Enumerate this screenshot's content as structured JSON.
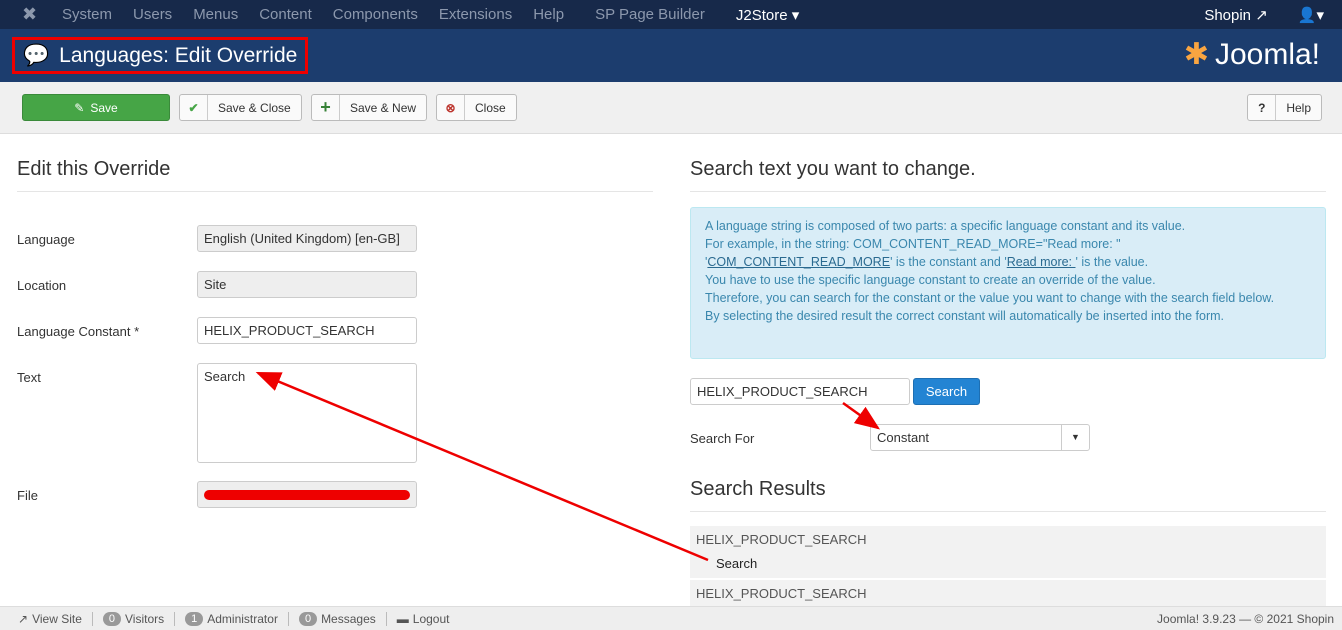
{
  "topnav": {
    "items": [
      "System",
      "Users",
      "Menus",
      "Content",
      "Components",
      "Extensions",
      "Help",
      "SP Page Builder"
    ],
    "j2store": "J2Store",
    "site": "Shopin"
  },
  "header": {
    "title": "Languages: Edit Override",
    "brand": "Joomla!"
  },
  "toolbar": {
    "save": "Save",
    "save_close": "Save & Close",
    "save_new": "Save & New",
    "close": "Close",
    "help": "Help"
  },
  "left": {
    "heading": "Edit this Override",
    "language_label": "Language",
    "language_value": "English (United Kingdom) [en-GB]",
    "location_label": "Location",
    "location_value": "Site",
    "constant_label": "Language Constant *",
    "constant_value": "HELIX_PRODUCT_SEARCH",
    "text_label": "Text",
    "text_value": "Search",
    "file_label": "File"
  },
  "right": {
    "heading": "Search text you want to change.",
    "info": {
      "l1": "A language string is composed of two parts: a specific language constant and its value.",
      "l2": "For example, in the string: COM_CONTENT_READ_MORE=\"Read more: \"",
      "l3a": "COM_CONTENT_READ_MORE",
      "l3b": "' is the constant and '",
      "l3c": "Read more: ",
      "l3d": "' is the value.",
      "l4": "You have to use the specific language constant to create an override of the value.",
      "l5": "Therefore, you can search for the constant or the value you want to change with the search field below.",
      "l6": "By selecting the desired result the correct constant will automatically be inserted into the form."
    },
    "search_value": "HELIX_PRODUCT_SEARCH",
    "search_button": "Search",
    "search_for_label": "Search For",
    "search_for_value": "Constant",
    "results_heading": "Search Results",
    "results": [
      {
        "constant": "HELIX_PRODUCT_SEARCH",
        "value": "Search"
      },
      {
        "constant": "HELIX_PRODUCT_SEARCH"
      }
    ]
  },
  "footer": {
    "view_site": "View Site",
    "visitors_count": "0",
    "visitors": "Visitors",
    "admin_count": "1",
    "admin": "Administrator",
    "messages_count": "0",
    "messages": "Messages",
    "logout": "Logout",
    "version": "Joomla! 3.9.23 — © 2021 Shopin"
  }
}
